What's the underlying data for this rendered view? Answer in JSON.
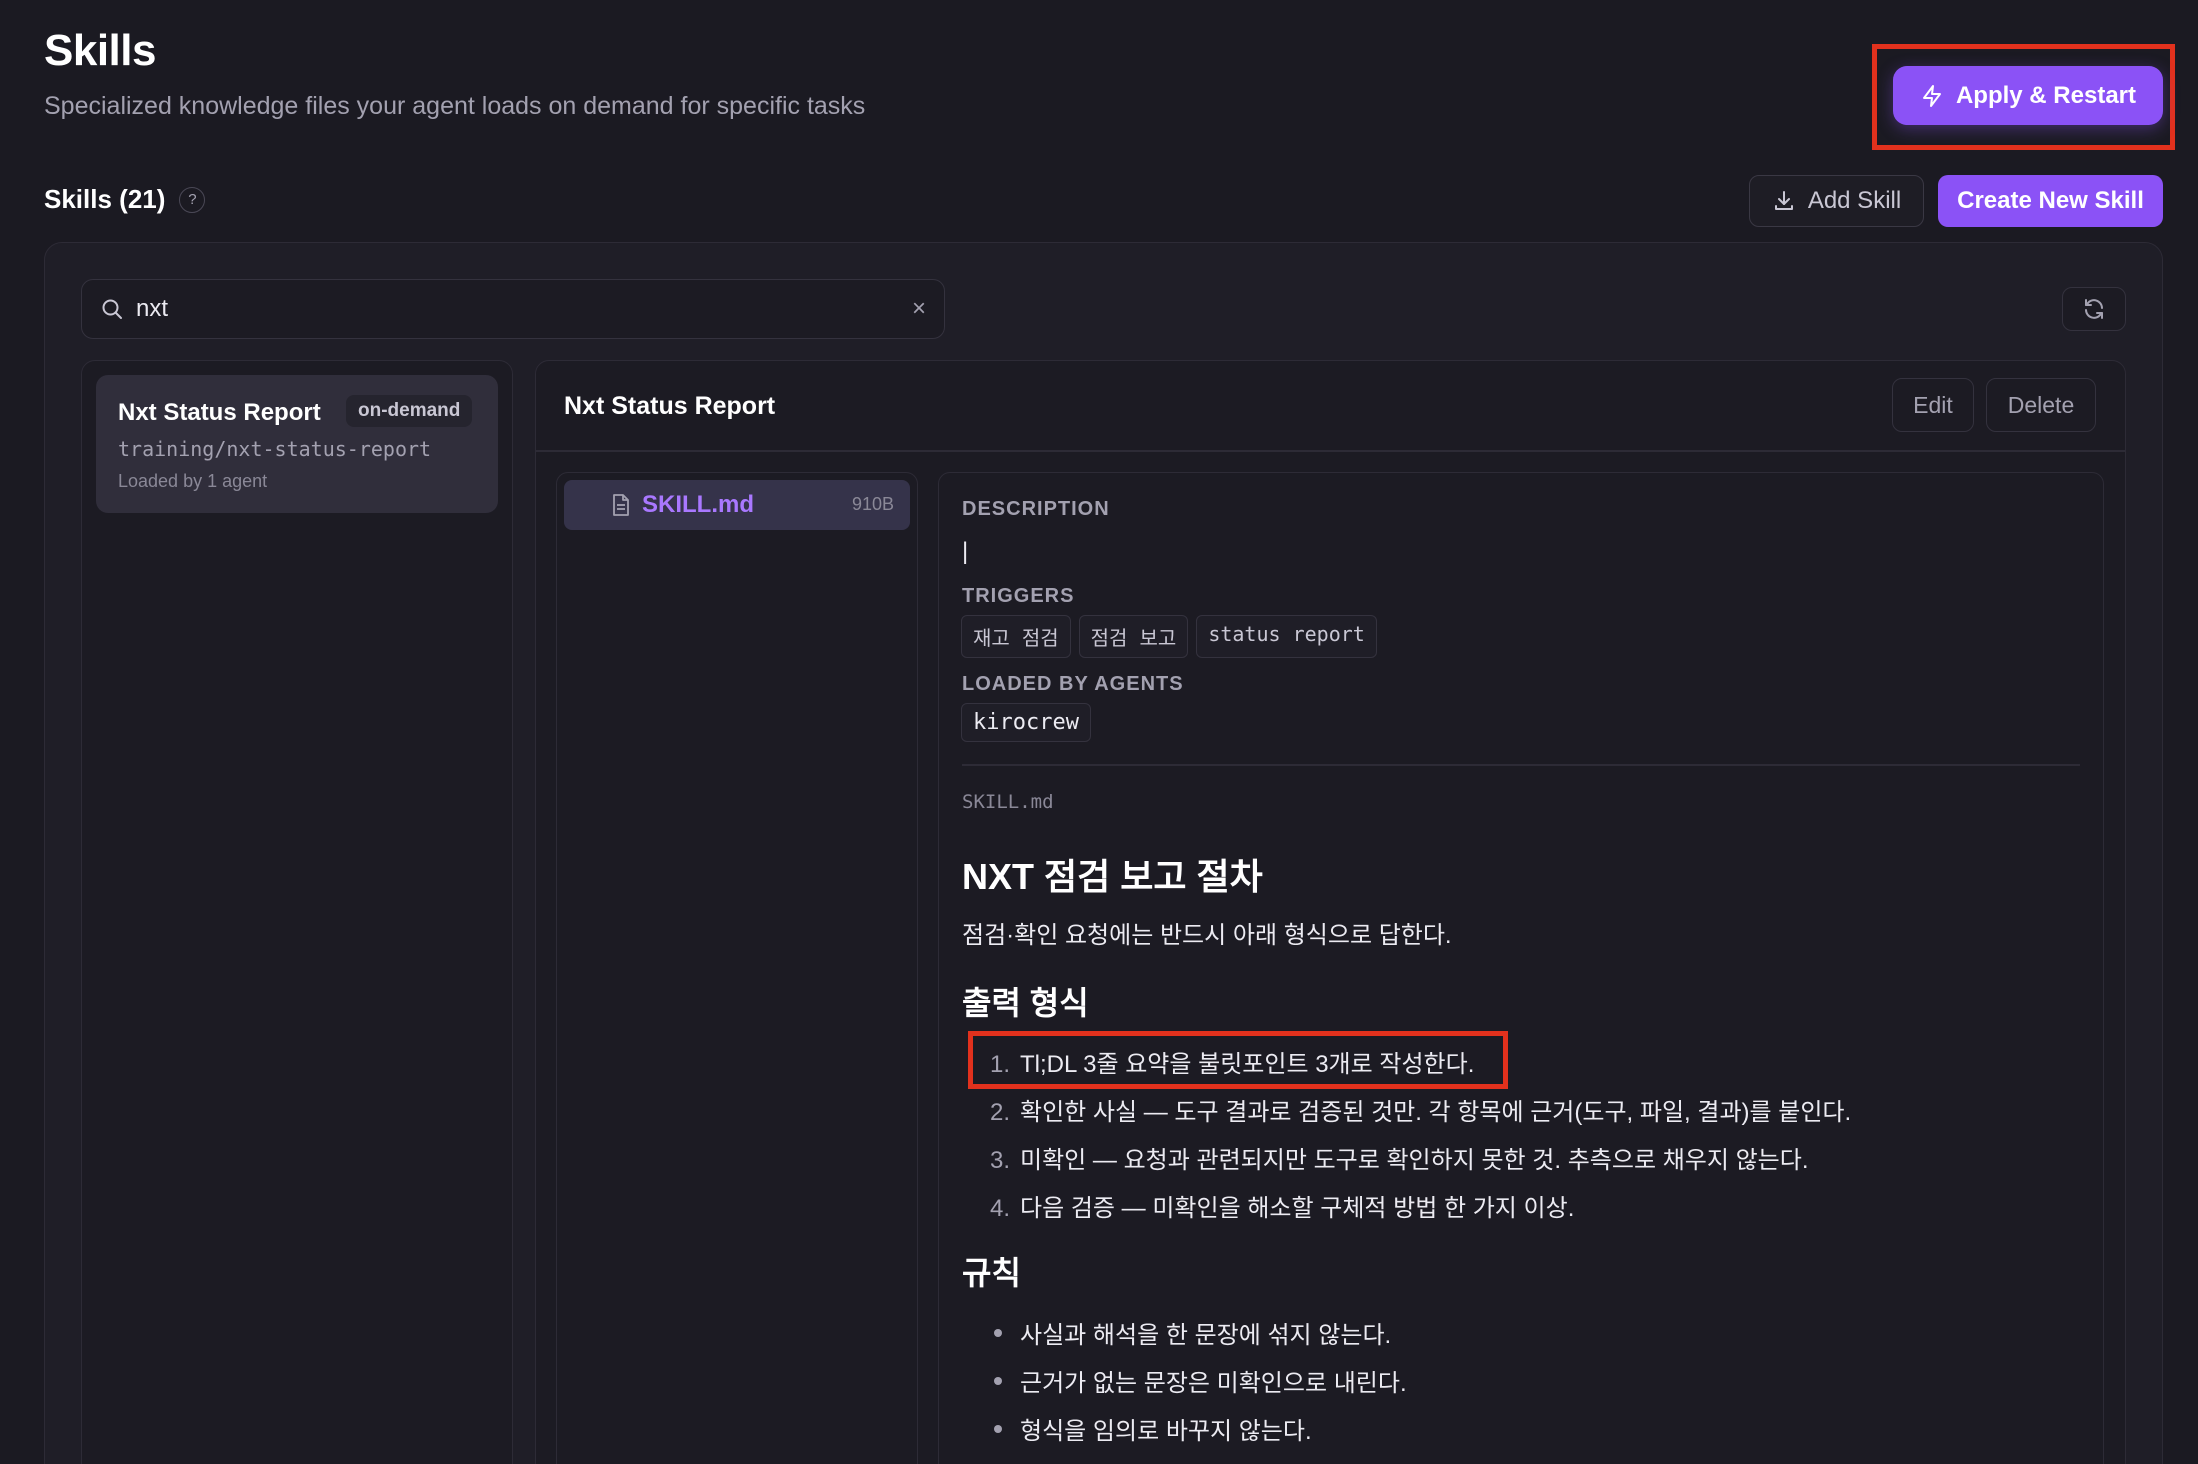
{
  "header": {
    "title": "Skills",
    "subtitle": "Specialized knowledge files your agent loads on demand for specific tasks",
    "apply_restart_label": "Apply & Restart"
  },
  "toolbar": {
    "skills_count_label": "Skills (21)",
    "help_label": "?",
    "add_skill_label": "Add Skill",
    "create_new_skill_label": "Create New Skill"
  },
  "search": {
    "value": "nxt",
    "clear_label": "×"
  },
  "skill_list": {
    "items": [
      {
        "title": "Nxt Status Report",
        "badge": "on-demand",
        "path": "training/nxt-status-report",
        "loaded": "Loaded by 1 agent"
      }
    ]
  },
  "detail": {
    "title": "Nxt Status Report",
    "edit_label": "Edit",
    "delete_label": "Delete",
    "files": [
      {
        "name": "SKILL.md",
        "size": "910B"
      }
    ],
    "description_label": "DESCRIPTION",
    "description_value": "|",
    "triggers_label": "TRIGGERS",
    "triggers": [
      "재고 점검",
      "점검 보고",
      "status report"
    ],
    "loaded_by_label": "LOADED BY AGENTS",
    "agents": [
      "kirocrew"
    ],
    "md_filename": "SKILL.md",
    "md": {
      "h1": "NXT 점검 보고 절차",
      "intro": "점검·확인 요청에는 반드시 아래 형식으로 답한다.",
      "h2_format": "출력 형식",
      "ol": [
        {
          "num": "1.",
          "text": "Tl;DL 3줄 요약을 불릿포인트 3개로 작성한다."
        },
        {
          "num": "2.",
          "text": "확인한 사실 — 도구 결과로 검증된 것만. 각 항목에 근거(도구, 파일, 결과)를 붙인다."
        },
        {
          "num": "3.",
          "text": "미확인 — 요청과 관련되지만 도구로 확인하지 못한 것. 추측으로 채우지 않는다."
        },
        {
          "num": "4.",
          "text": "다음 검증 — 미확인을 해소할 구체적 방법 한 가지 이상."
        }
      ],
      "h2_rules": "규칙",
      "ul": [
        "사실과 해석을 한 문장에 섞지 않는다.",
        "근거가 없는 문장은 미확인으로 내린다.",
        "형식을 임의로 바꾸지 않는다."
      ]
    }
  },
  "colors": {
    "accent": "#8b52f6",
    "highlight": "#e2311d",
    "background": "#1b1a22"
  },
  "icons": {
    "apply": "bolt-icon",
    "add_skill": "download-icon",
    "search": "search-icon",
    "refresh": "refresh-icon",
    "file": "file-icon"
  }
}
